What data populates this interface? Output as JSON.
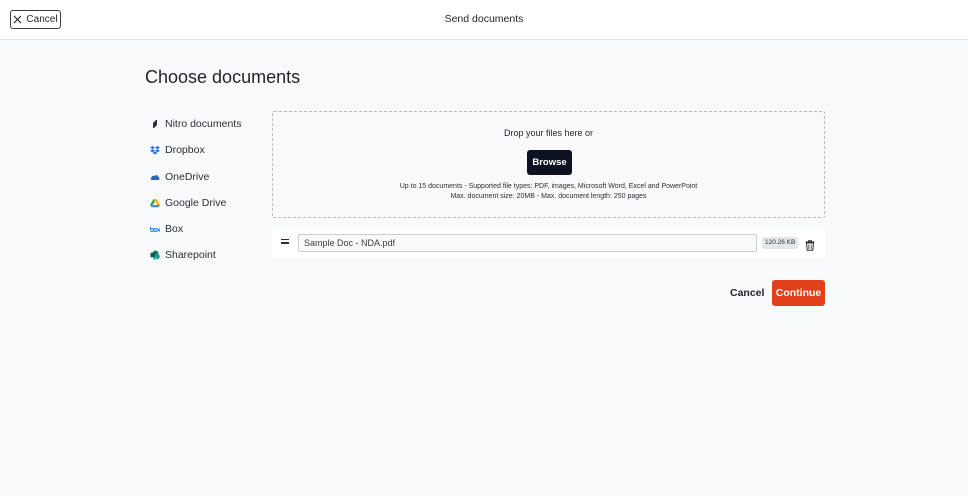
{
  "topbar": {
    "cancel_label": "Cancel",
    "title": "Send documents"
  },
  "main": {
    "title": "Choose documents"
  },
  "sources": [
    {
      "label": "Nitro documents",
      "icon": "nitro-icon",
      "color": "#2b2f34"
    },
    {
      "label": "Dropbox",
      "icon": "dropbox-icon",
      "color": "#2e6fdc"
    },
    {
      "label": "OneDrive",
      "icon": "onedrive-icon",
      "color": "#2b63b8"
    },
    {
      "label": "Google Drive",
      "icon": "google-drive-icon",
      "color": "#34a853"
    },
    {
      "label": "Box",
      "icon": "box-icon",
      "color": "#1a82e2"
    },
    {
      "label": "Sharepoint",
      "icon": "sharepoint-icon",
      "color": "#0f7b6c"
    }
  ],
  "dropzone": {
    "prompt": "Drop your files here or",
    "browse_label": "Browse",
    "info_line1": "Up to 15 documents - Supported file types: PDF, images, Microsoft Word, Excel and PowerPoint",
    "info_line2": "Max. document size: 20MB - Max. document length: 250 pages"
  },
  "files": [
    {
      "name": "Sample Doc - NDA.pdf",
      "size": "120.26 KB"
    }
  ],
  "actions": {
    "cancel_label": "Cancel",
    "continue_label": "Continue"
  },
  "colors": {
    "accent": "#e2401b",
    "browse_bg": "#0e1220"
  }
}
